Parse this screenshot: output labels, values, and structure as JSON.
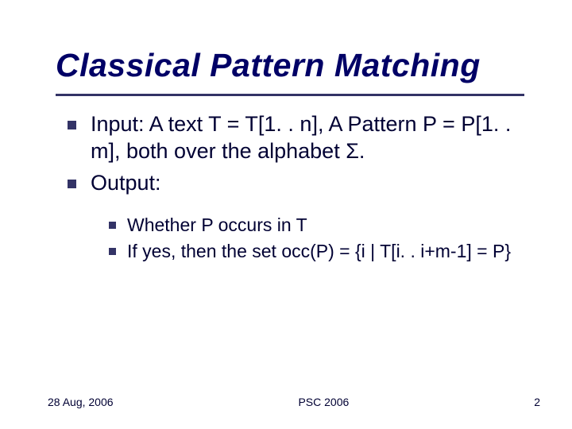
{
  "title": "Classical Pattern Matching",
  "bullets": [
    {
      "text": "Input: A text T = T[1. . n], A Pattern P = P[1. . m], both over the alphabet Σ."
    },
    {
      "text": "Output:"
    }
  ],
  "sub_bullets": [
    {
      "text": "Whether P occurs in T"
    },
    {
      "text": "If yes, then the set occ(P) = {i | T[i. . i+m-1] = P}"
    }
  ],
  "footer": {
    "date": "28 Aug, 2006",
    "center": "PSC 2006",
    "page": "2"
  }
}
